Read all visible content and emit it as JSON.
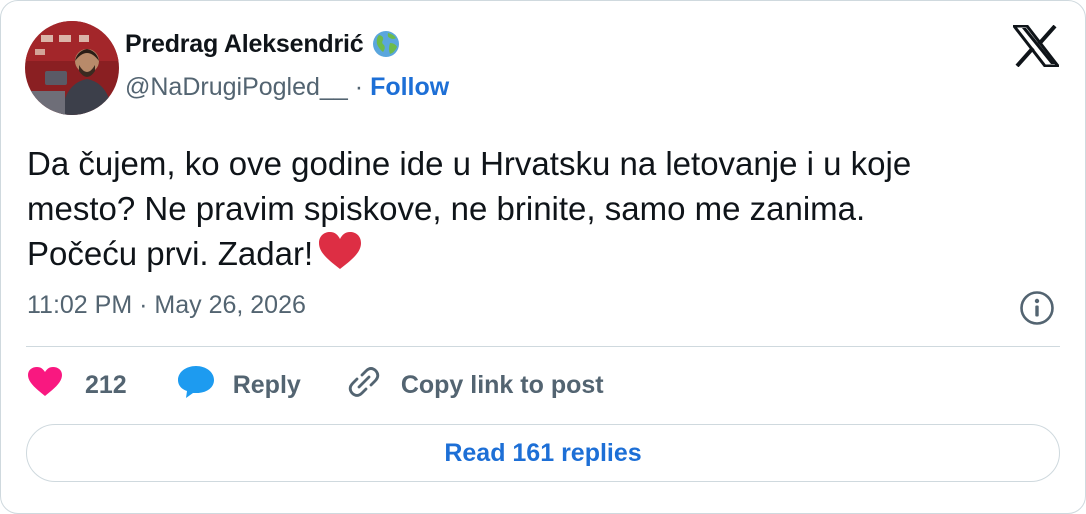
{
  "author": {
    "name": "Predrag Aleksendrić",
    "handle": "@NaDrugiPogled__",
    "separator": "·",
    "follow_label": "Follow",
    "badge_icon": "globe-emoji"
  },
  "tweet": {
    "lines": [
      "Da čujem, ko ove godine ide u Hrvatsku na letovanje i u koje",
      "mesto? Ne pravim spiskove, ne brinite, samo me zanima.",
      "Počeću prvi. Zadar!"
    ],
    "emoji": "red-heart-emoji"
  },
  "meta": {
    "time": "11:02 PM",
    "separator": "·",
    "date": "May 26, 2026"
  },
  "actions": {
    "like_count": "212",
    "reply_label": "Reply",
    "copy_label": "Copy link to post"
  },
  "read_replies_label": "Read 161 replies",
  "colors": {
    "accent": "#1d6fd6",
    "like": "#f91880",
    "reply": "#1d9bf0",
    "muted": "#536471",
    "heart_emoji": "#dd2e44"
  }
}
